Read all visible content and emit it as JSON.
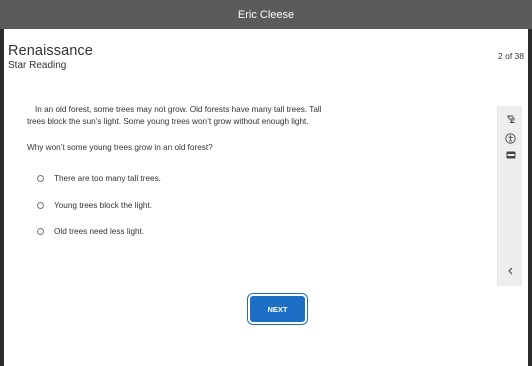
{
  "header": {
    "user_name": "Eric Cleese"
  },
  "app": {
    "brand": "Renaissance",
    "product": "Star Reading",
    "progress": "2 of 38"
  },
  "passage": {
    "line1": "In an old forest, some trees may not grow. Old forests have many tall trees. Tall",
    "line2": "trees block the sun’s light. Some young trees won’t grow without enough light."
  },
  "question": "Why won’t some young trees grow in an old forest?",
  "options": [
    {
      "label": "There are too many tall trees."
    },
    {
      "label": "Young trees block the light."
    },
    {
      "label": "Old trees need less light."
    }
  ],
  "tools": [
    {
      "icon": "text-to-speech-icon"
    },
    {
      "icon": "accessibility-icon"
    },
    {
      "icon": "line-reader-icon"
    },
    {
      "icon": "chevron-left-icon"
    }
  ],
  "footer": {
    "next_label": "NEXT"
  },
  "colors": {
    "topbar": "#5b5b5b",
    "accent": "#1c6fc4",
    "tool_panel": "#eeeeee"
  }
}
